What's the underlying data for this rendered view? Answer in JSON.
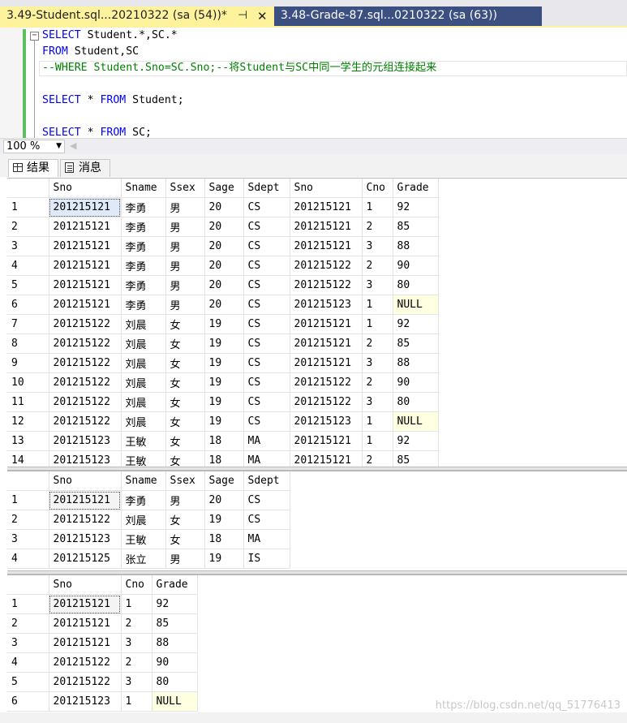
{
  "tabs": [
    {
      "title": "3.49-Student.sql...20210322 (sa (54))*",
      "active": true
    },
    {
      "title": "3.48-Grade-87.sql...0210322 (sa (63))",
      "active": false
    }
  ],
  "editor": {
    "lines": [
      {
        "parts": [
          {
            "t": "SELECT",
            "k": "kw"
          },
          {
            "t": " Student.*,SC.*",
            "k": "tx"
          }
        ]
      },
      {
        "parts": [
          {
            "t": "FROM",
            "k": "kw"
          },
          {
            "t": " Student,SC",
            "k": "tx"
          }
        ]
      },
      {
        "parts": [
          {
            "t": "--WHERE Student.Sno=SC.Sno;--将Student与SC中同一学生的元组连接起来",
            "k": "cm"
          }
        ]
      },
      {
        "parts": []
      },
      {
        "parts": [
          {
            "t": "SELECT",
            "k": "kw"
          },
          {
            "t": " * ",
            "k": "tx"
          },
          {
            "t": "FROM",
            "k": "kw"
          },
          {
            "t": " Student;",
            "k": "tx"
          }
        ]
      },
      {
        "parts": []
      },
      {
        "parts": [
          {
            "t": "SELECT",
            "k": "kw"
          },
          {
            "t": " * ",
            "k": "tx"
          },
          {
            "t": "FROM",
            "k": "kw"
          },
          {
            "t": " SC;",
            "k": "tx"
          }
        ]
      }
    ]
  },
  "zoom": "100 %",
  "results_tabs": {
    "results": "结果",
    "messages": "消息"
  },
  "grids": [
    {
      "columns": [
        "",
        "Sno",
        "Sname",
        "Ssex",
        "Sage",
        "Sdept",
        "Sno",
        "Cno",
        "Grade"
      ],
      "rows": [
        [
          "1",
          "201215121",
          "李勇",
          "男",
          "20",
          "CS",
          "201215121",
          "1",
          "92"
        ],
        [
          "2",
          "201215121",
          "李勇",
          "男",
          "20",
          "CS",
          "201215121",
          "2",
          "85"
        ],
        [
          "3",
          "201215121",
          "李勇",
          "男",
          "20",
          "CS",
          "201215121",
          "3",
          "88"
        ],
        [
          "4",
          "201215121",
          "李勇",
          "男",
          "20",
          "CS",
          "201215122",
          "2",
          "90"
        ],
        [
          "5",
          "201215121",
          "李勇",
          "男",
          "20",
          "CS",
          "201215122",
          "3",
          "80"
        ],
        [
          "6",
          "201215121",
          "李勇",
          "男",
          "20",
          "CS",
          "201215123",
          "1",
          "NULL"
        ],
        [
          "7",
          "201215122",
          "刘晨",
          "女",
          "19",
          "CS",
          "201215121",
          "1",
          "92"
        ],
        [
          "8",
          "201215122",
          "刘晨",
          "女",
          "19",
          "CS",
          "201215121",
          "2",
          "85"
        ],
        [
          "9",
          "201215122",
          "刘晨",
          "女",
          "19",
          "CS",
          "201215121",
          "3",
          "88"
        ],
        [
          "10",
          "201215122",
          "刘晨",
          "女",
          "19",
          "CS",
          "201215122",
          "2",
          "90"
        ],
        [
          "11",
          "201215122",
          "刘晨",
          "女",
          "19",
          "CS",
          "201215122",
          "3",
          "80"
        ],
        [
          "12",
          "201215122",
          "刘晨",
          "女",
          "19",
          "CS",
          "201215123",
          "1",
          "NULL"
        ],
        [
          "13",
          "201215123",
          "王敏",
          "女",
          "18",
          "MA",
          "201215121",
          "1",
          "92"
        ],
        [
          "14",
          "201215123",
          "王敏",
          "女",
          "18",
          "MA",
          "201215121",
          "2",
          "85"
        ]
      ]
    },
    {
      "columns": [
        "",
        "Sno",
        "Sname",
        "Ssex",
        "Sage",
        "Sdept"
      ],
      "rows": [
        [
          "1",
          "201215121",
          "李勇",
          "男",
          "20",
          "CS"
        ],
        [
          "2",
          "201215122",
          "刘晨",
          "女",
          "19",
          "CS"
        ],
        [
          "3",
          "201215123",
          "王敏",
          "女",
          "18",
          "MA"
        ],
        [
          "4",
          "201215125",
          "张立",
          "男",
          "19",
          "IS"
        ]
      ]
    },
    {
      "columns": [
        "",
        "Sno",
        "Cno",
        "Grade"
      ],
      "rows": [
        [
          "1",
          "201215121",
          "1",
          "92"
        ],
        [
          "2",
          "201215121",
          "2",
          "85"
        ],
        [
          "3",
          "201215121",
          "3",
          "88"
        ],
        [
          "4",
          "201215122",
          "2",
          "90"
        ],
        [
          "5",
          "201215122",
          "3",
          "80"
        ],
        [
          "6",
          "201215123",
          "1",
          "NULL"
        ]
      ]
    }
  ],
  "watermark": "https://blog.csdn.net/qq_51776413"
}
